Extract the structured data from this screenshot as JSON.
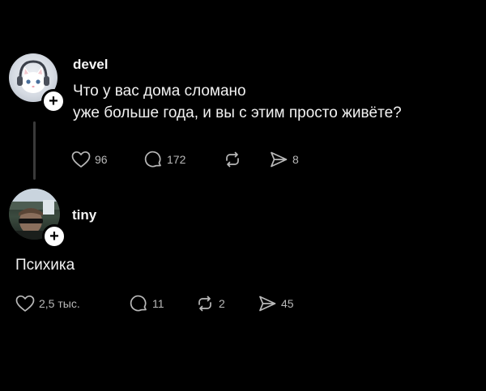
{
  "posts": [
    {
      "username": "devel",
      "text_lines": [
        "Что у вас дома сломано",
        "уже больше года, и вы с этим просто живёте?"
      ],
      "likes": "96",
      "comments": "172",
      "reposts": "",
      "shares": "8",
      "avatar_icon": "white-kitten-with-headphones"
    },
    {
      "username": "tiny",
      "text": "Психика",
      "likes": "2,5 тыс.",
      "comments": "11",
      "reposts": "2",
      "shares": "45",
      "avatar_icon": "person-photo"
    }
  ],
  "colors": {
    "background": "#000000",
    "text": "#f2f2f2",
    "secondary_text": "#b9b9b9",
    "thread_line": "#3a3a3a"
  }
}
